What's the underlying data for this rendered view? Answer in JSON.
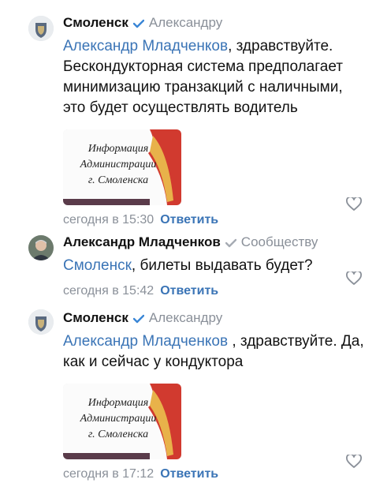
{
  "comments": [
    {
      "author": "Смоленск",
      "verified": true,
      "to": "Александру",
      "mention": "Александр Младченков",
      "text": ", здравствуйте. Бескондукторная система предполагает минимизацию транзакций с наличными, это будет осуществлять водитель",
      "attachment": {
        "lines": [
          "Информация",
          "Администрации",
          "г. Смоленска"
        ]
      },
      "time": "сегодня в 15:30",
      "reply_label": "Ответить"
    },
    {
      "author": "Александр Младченков",
      "verified": true,
      "to": "Сообществу",
      "mention": "Смоленск",
      "text": ", билеты выдавать будет?",
      "time": "сегодня в 15:42",
      "reply_label": "Ответить"
    },
    {
      "author": "Смоленск",
      "verified": true,
      "to": "Александру",
      "mention": "Александр Младченков",
      "text": " , здравствуйте. Да, как и сейчас у кондуктора",
      "attachment": {
        "lines": [
          "Информация",
          "Администрации",
          "г. Смоленска"
        ]
      },
      "time": "сегодня в 17:12",
      "reply_label": "Ответить"
    }
  ],
  "colors": {
    "link": "#3a74b6",
    "meta": "#8a9099",
    "check_blue": "#3a86d6",
    "check_gray": "#a6abb3"
  },
  "icons": {
    "verified": "check-icon",
    "like": "heart-icon"
  }
}
